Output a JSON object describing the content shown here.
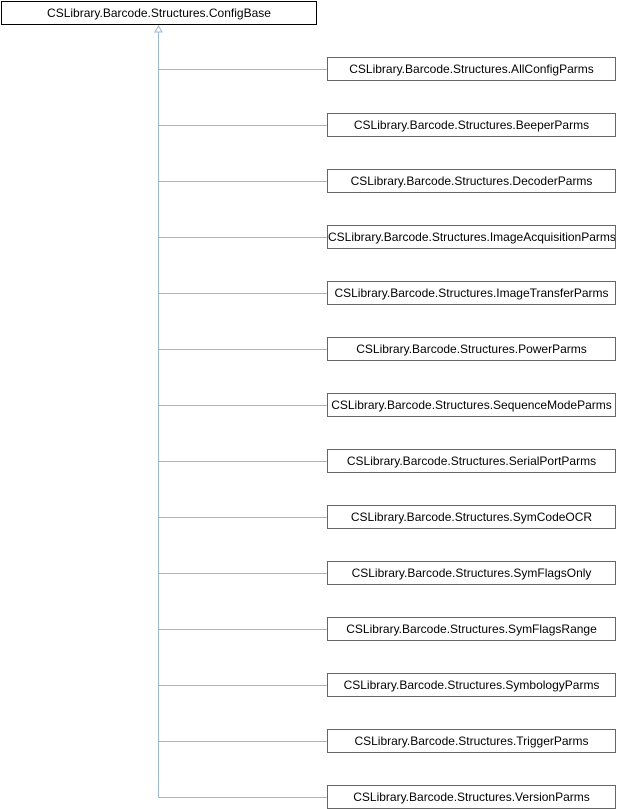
{
  "diagram": {
    "base": {
      "label": "CSLibrary.Barcode.Structures.ConfigBase"
    },
    "children": [
      {
        "label": "CSLibrary.Barcode.Structures.AllConfigParms"
      },
      {
        "label": "CSLibrary.Barcode.Structures.BeeperParms"
      },
      {
        "label": "CSLibrary.Barcode.Structures.DecoderParms"
      },
      {
        "label": "CSLibrary.Barcode.Structures.ImageAcquisitionParms"
      },
      {
        "label": "CSLibrary.Barcode.Structures.ImageTransferParms"
      },
      {
        "label": "CSLibrary.Barcode.Structures.PowerParms"
      },
      {
        "label": "CSLibrary.Barcode.Structures.SequenceModeParms"
      },
      {
        "label": "CSLibrary.Barcode.Structures.SerialPortParms"
      },
      {
        "label": "CSLibrary.Barcode.Structures.SymCodeOCR"
      },
      {
        "label": "CSLibrary.Barcode.Structures.SymFlagsOnly"
      },
      {
        "label": "CSLibrary.Barcode.Structures.SymFlagsRange"
      },
      {
        "label": "CSLibrary.Barcode.Structures.SymbologyParms"
      },
      {
        "label": "CSLibrary.Barcode.Structures.TriggerParms"
      },
      {
        "label": "CSLibrary.Barcode.Structures.VersionParms"
      }
    ],
    "colors": {
      "connector": "#9bb8d4",
      "node_border": "#666666",
      "base_border": "#000000"
    }
  }
}
